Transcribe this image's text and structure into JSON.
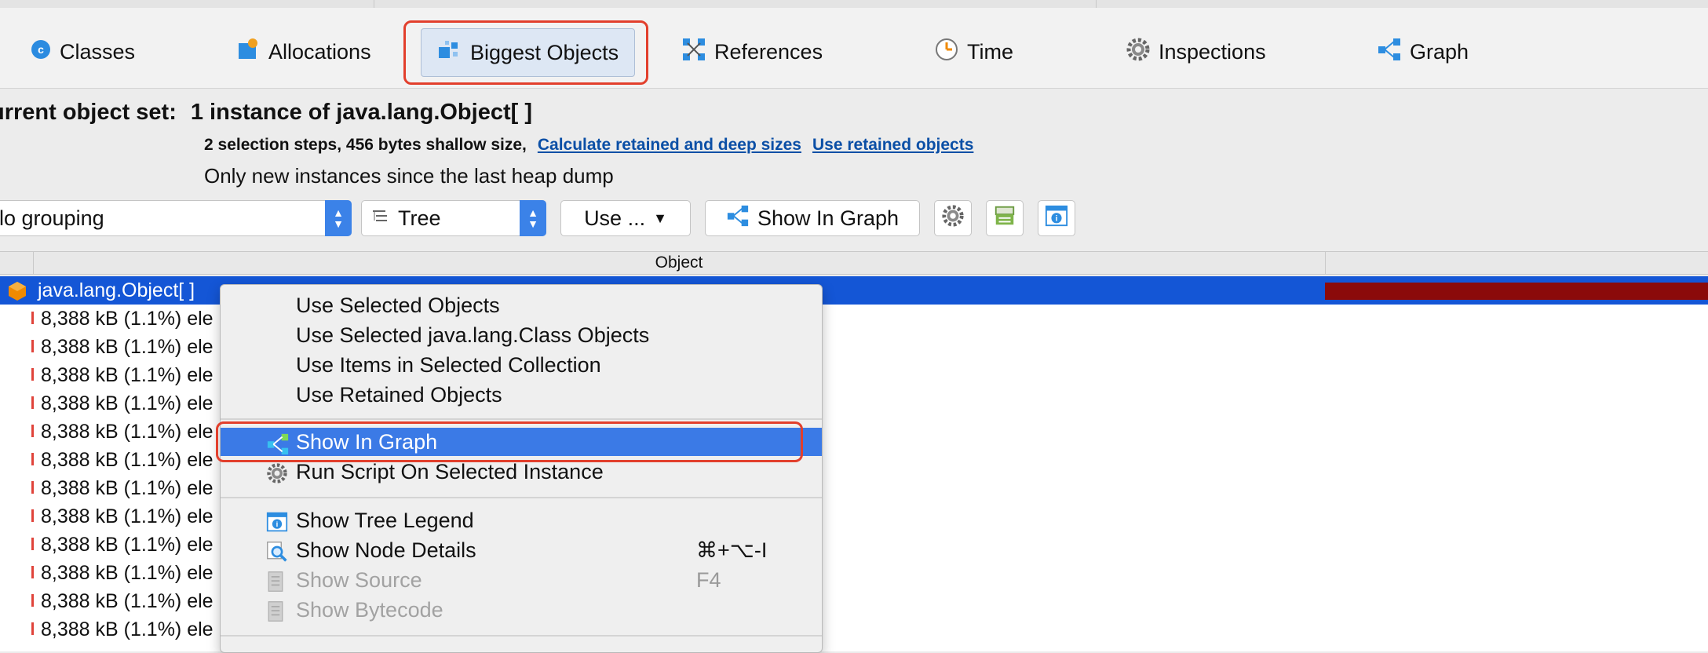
{
  "tabs": [
    {
      "label": "Classes",
      "icon": "classes-icon"
    },
    {
      "label": "Allocations",
      "icon": "allocations-icon"
    },
    {
      "label": "Biggest Objects",
      "icon": "biggest-objects-icon",
      "active": true
    },
    {
      "label": "References",
      "icon": "references-icon"
    },
    {
      "label": "Time",
      "icon": "time-icon"
    },
    {
      "label": "Inspections",
      "icon": "inspections-icon"
    },
    {
      "label": "Graph",
      "icon": "graph-icon"
    }
  ],
  "header": {
    "label": "urrent object set:",
    "value": "1 instance of java.lang.Object[ ]",
    "steps": "2 selection steps, 456 bytes shallow size,",
    "link_calculate": "Calculate retained and deep sizes",
    "link_retained": "Use retained objects",
    "note": "Only new instances since the last heap dump"
  },
  "toolbar": {
    "grouping_value": "lo grouping",
    "view_value": "Tree",
    "use_button": "Use ...",
    "show_in_graph_button": "Show In Graph"
  },
  "table": {
    "column_object": "Object",
    "selected_row": "java.lang.Object[ ]",
    "rows": [
      "8,388 kB (1.1%) ele",
      "8,388 kB (1.1%) ele",
      "8,388 kB (1.1%) ele",
      "8,388 kB (1.1%) ele",
      "8,388 kB (1.1%) ele",
      "8,388 kB (1.1%) ele",
      "8,388 kB (1.1%) ele",
      "8,388 kB (1.1%) ele",
      "8,388 kB (1.1%) ele",
      "8,388 kB (1.1%) ele",
      "8,388 kB (1.1%) ele",
      "8,388 kB (1.1%) ele"
    ]
  },
  "context_menu": {
    "use_selected": "Use Selected Objects",
    "use_selected_class": "Use Selected java.lang.Class Objects",
    "use_items": "Use Items in Selected Collection",
    "use_retained": "Use Retained Objects",
    "show_in_graph": "Show In Graph",
    "run_script": "Run Script On Selected Instance",
    "show_tree_legend": "Show Tree Legend",
    "show_node_details": "Show Node Details",
    "show_node_details_shortcut": "⌘+⌥-I",
    "show_source": "Show Source",
    "show_source_shortcut": "F4",
    "show_bytecode": "Show Bytecode"
  },
  "colors": {
    "accent": "#3b7ae6",
    "selection": "#1456d6",
    "highlight_box": "#e23f2c",
    "retained_bar": "#8b0a0a",
    "link": "#0b4fa6"
  }
}
